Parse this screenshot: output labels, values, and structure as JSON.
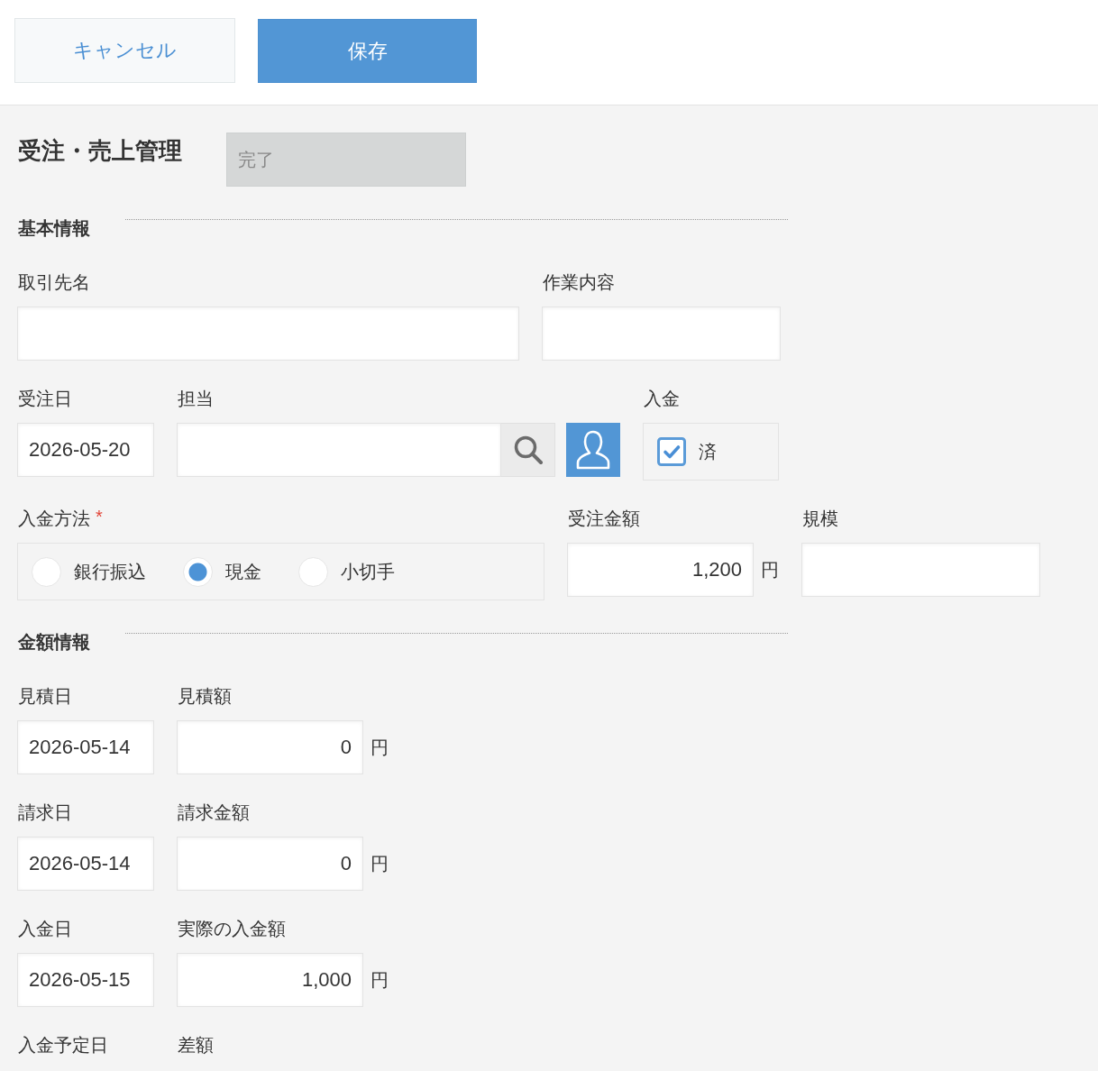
{
  "toolbar": {
    "buttons": [
      {
        "kind": "cancel",
        "label": "キャンセル"
      },
      {
        "kind": "save",
        "label": "保存"
      }
    ]
  },
  "header": {
    "title": "受注・売上管理",
    "status": {
      "value": "完了",
      "disabled": true
    }
  },
  "sections": [
    {
      "title": "基本情報",
      "rows": [
        [
          {
            "kind": "text",
            "label": "取引先名"
          },
          {
            "kind": "text",
            "label": "作業内容"
          }
        ],
        [
          {
            "kind": "date",
            "label": "受注日",
            "value": "2026-05-20"
          },
          {
            "kind": "user",
            "label": "担当"
          },
          {
            "kind": "checkbox",
            "label": "入金",
            "option": "済",
            "checked": true
          }
        ],
        [
          {
            "kind": "radio",
            "label": "入金方法",
            "required_mark": "*",
            "options": [
              {
                "label": "銀行振込",
                "selected": false
              },
              {
                "label": "現金",
                "selected": true
              },
              {
                "label": "小切手",
                "selected": false
              }
            ]
          },
          {
            "kind": "amount",
            "label": "受注金額",
            "value": "1,200",
            "unit": "円"
          },
          {
            "kind": "text",
            "label": "規模"
          }
        ]
      ]
    },
    {
      "title": "金額情報",
      "rows": [
        [
          {
            "kind": "date",
            "label": "見積日",
            "value": "2026-05-14"
          },
          {
            "kind": "amount",
            "label": "見積額",
            "value": "0",
            "unit": "円"
          }
        ],
        [
          {
            "kind": "date",
            "label": "請求日",
            "value": "2026-05-14"
          },
          {
            "kind": "amount",
            "label": "請求金額",
            "value": "0",
            "unit": "円"
          }
        ],
        [
          {
            "kind": "date",
            "label": "入金日",
            "value": "2026-05-15"
          },
          {
            "kind": "amount",
            "label": "実際の入金額",
            "value": "1,000",
            "unit": "円"
          }
        ],
        [
          {
            "kind": "label",
            "label": "入金予定日"
          },
          {
            "kind": "label",
            "label": "差額"
          }
        ]
      ]
    }
  ]
}
